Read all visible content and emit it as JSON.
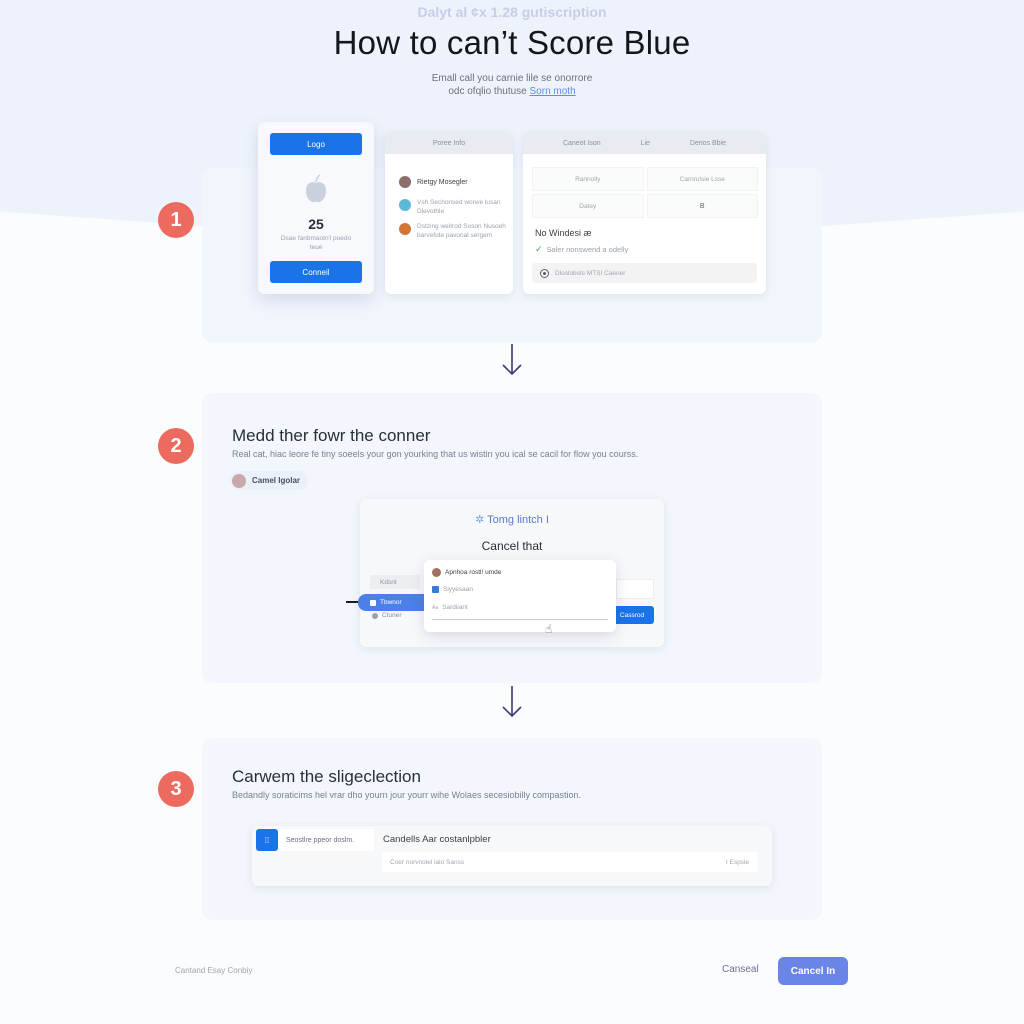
{
  "header": {
    "eyebrow": "Dalyt al ¢x 1.28 gutiscription",
    "title": "How to can’t Score Blue",
    "subtitle_line1": "Emall call you carnie lile se onorrore",
    "subtitle_line2": "odc ofqlio thutuse",
    "subtitle_link": "Sorn moth"
  },
  "steps": [
    {
      "number": "1",
      "login_card": {
        "top_button": "Logo",
        "icon": "apple-icon",
        "count": "25",
        "caption": "Dsae fanbmaotn'l puedo teue",
        "bottom_button": "Conneil"
      },
      "people_card": {
        "header": "Poree Info",
        "items": [
          {
            "name": "Rietgy Mosegler",
            "text": "",
            "avatar_color": "#8a6f6a"
          },
          {
            "name": "",
            "text": "Vsh Sechonsed worwe lusan Dlevothle",
            "avatar_color": "#5fb7d8"
          },
          {
            "name": "",
            "text": "Dstzing weitrod Soson Nusoeh barvefute pavonal sergem",
            "avatar_color": "#d0763a"
          }
        ]
      },
      "detail_card": {
        "tabs": [
          "Caneot Ison",
          "Lie",
          "Denos Bbie"
        ],
        "grid": [
          [
            "Rannolly",
            "Carnrulsie Lsse"
          ],
          [
            "Datey",
            "B"
          ]
        ],
        "section_title": "No Windesi æ",
        "check_text": "Saler nonswend a odelly",
        "radio_text": "Dloslobsts MTSI Caener"
      }
    },
    {
      "number": "2",
      "heading": "Medd ther fowr the conner",
      "description": "Real cat, hiac leore fe tiny soeels your gon yourking that us wistin you ical se cacil for flow you courss.",
      "chip": "Camel Igolar",
      "dialog": {
        "brand": "Tomg lintch I",
        "title": "Cancel that",
        "side_items": [
          "Kdsnt",
          "Tbwnor",
          "Ctuner"
        ],
        "popup_items": [
          "Apnhoa rostl! umde",
          "Siyyesaan",
          "Sardiiant"
        ],
        "action_button": "Cassrod"
      }
    },
    {
      "number": "3",
      "heading": "Carwem the sligeclection",
      "description": "Bedandly soraticims hel vrar dho yourn jour yourr wihe Wolaes secesiobilly compastion.",
      "tab_label": "Seostlre ppeor doslm.",
      "panel_title": "Candells Aar costanlpbler",
      "input_value": "Coer norvnolel lalo Sanss",
      "input_suffix": "I Espsie"
    }
  ],
  "footer": {
    "left_text": "Cantand Esay Conbiy",
    "cancel": "Canseal",
    "primary": "Cancel In"
  },
  "colors": {
    "accent": "#1a73e8",
    "badge": "#ec6a5e",
    "primary_button": "#6b84e8",
    "arrow": "#3a3a7a"
  }
}
